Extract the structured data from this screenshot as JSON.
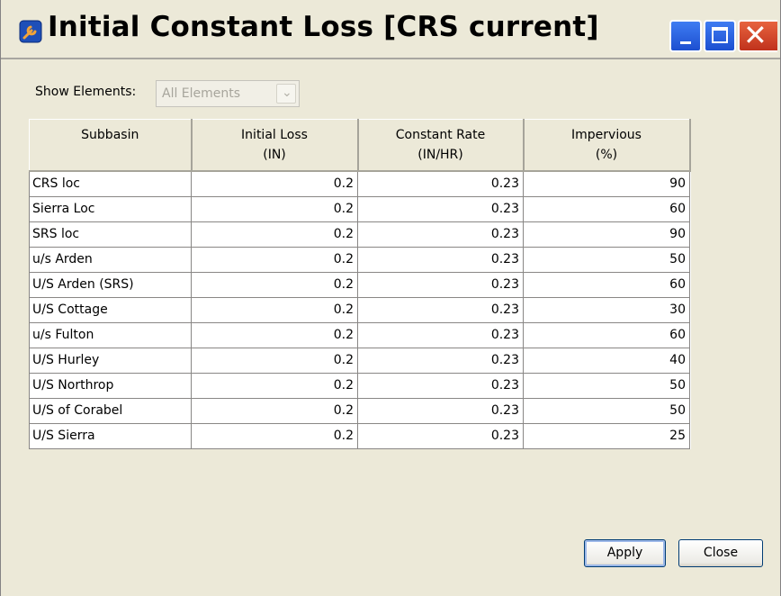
{
  "window": {
    "title": "Initial Constant Loss [CRS current]"
  },
  "filter": {
    "label": "Show Elements:",
    "value": "All Elements"
  },
  "table": {
    "headers": [
      [
        "Subbasin",
        ""
      ],
      [
        "Initial Loss",
        "(IN)"
      ],
      [
        "Constant Rate",
        "(IN/HR)"
      ],
      [
        "Impervious",
        "(%)"
      ]
    ],
    "rows": [
      [
        "CRS loc",
        "0.2",
        "0.23",
        "90"
      ],
      [
        "Sierra Loc",
        "0.2",
        "0.23",
        "60"
      ],
      [
        "SRS loc",
        "0.2",
        "0.23",
        "90"
      ],
      [
        "u/s Arden",
        "0.2",
        "0.23",
        "50"
      ],
      [
        "U/S Arden (SRS)",
        "0.2",
        "0.23",
        "60"
      ],
      [
        "U/S Cottage",
        "0.2",
        "0.23",
        "30"
      ],
      [
        "u/s Fulton",
        "0.2",
        "0.23",
        "60"
      ],
      [
        "U/S Hurley",
        "0.2",
        "0.23",
        "40"
      ],
      [
        "U/S Northrop",
        "0.2",
        "0.23",
        "50"
      ],
      [
        "U/S of Corabel",
        "0.2",
        "0.23",
        "50"
      ],
      [
        "U/S Sierra",
        "0.2",
        "0.23",
        "25"
      ]
    ]
  },
  "buttons": {
    "apply": "Apply",
    "close": "Close"
  }
}
